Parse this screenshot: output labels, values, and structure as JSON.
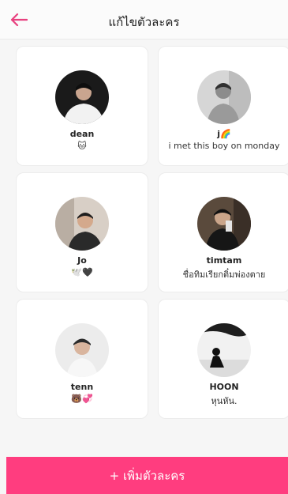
{
  "header": {
    "title": "แก้ไขตัวละคร",
    "back_icon": "arrow-left-icon",
    "accent": "#e8417f"
  },
  "characters": [
    {
      "name": "dean",
      "bio": "🐱"
    },
    {
      "name": "j🌈",
      "bio": "i met this boy on monday"
    },
    {
      "name": "Jo",
      "bio": "🕊️🖤"
    },
    {
      "name": "timtam",
      "bio": "ชื่อทิมเรียกติ๋มพ่องตาย"
    },
    {
      "name": "tenn",
      "bio": "🐻💞"
    },
    {
      "name": "HOON",
      "bio": "หุนหัน."
    }
  ],
  "add_button": {
    "label": "+ เพิ่มตัวละคร",
    "color": "#ff3d7f"
  }
}
